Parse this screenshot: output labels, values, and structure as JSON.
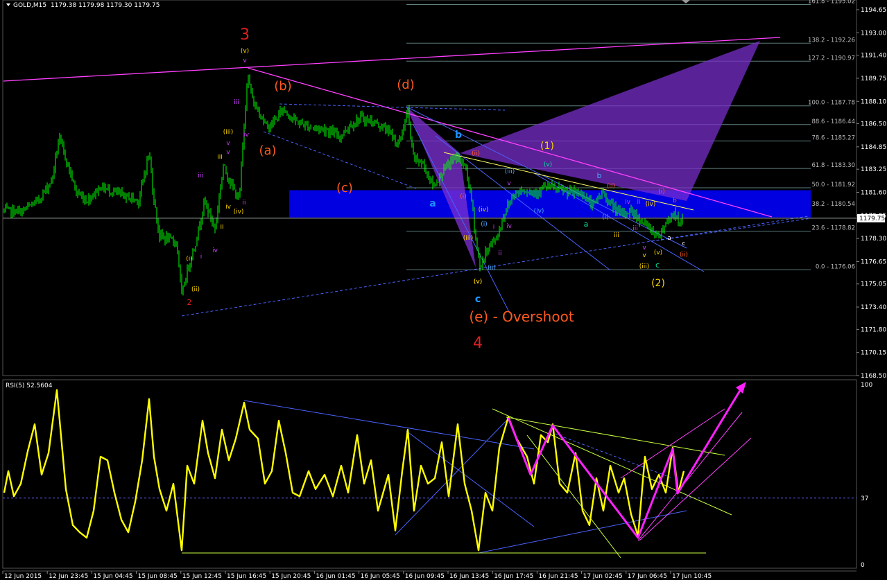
{
  "header": {
    "symbol_label": "GOLD,M15",
    "ohlc": "1179.38 1179.98 1179.30 1179.75",
    "rsi_label": "RSI(5) 52.5604"
  },
  "colors": {
    "background": "#000000",
    "candle": "#00ff00",
    "rsi_line": "#ffff00",
    "fib_line": "#5f7f7f",
    "zone": "#0000e0",
    "pattern": "#7b2fd0",
    "trendline": "#ff40ff",
    "channel": "#4a63ff"
  },
  "chart_data": [
    {
      "type": "candlestick",
      "price_axis": {
        "ticks": [
          "1194.65",
          "1193.00",
          "1191.40",
          "1189.75",
          "1188.10",
          "1186.50",
          "1184.85",
          "1183.25",
          "1181.60",
          "1179.95",
          "1178.30",
          "1176.65",
          "1175.05",
          "1173.40",
          "1171.80",
          "1170.15",
          "1168.50"
        ],
        "current_price": "1179.75",
        "ylim": [
          1168.1,
          1195.2
        ]
      },
      "x_axis": {
        "ticks": [
          "12 Jun 2015",
          "12 Jun 23:45",
          "15 Jun 04:45",
          "15 Jun 08:45",
          "15 Jun 12:45",
          "15 Jun 16:45",
          "15 Jun 20:45",
          "16 Jun 01:45",
          "16 Jun 05:45",
          "16 Jun 09:45",
          "16 Jun 13:45",
          "16 Jun 17:45",
          "16 Jun 21:45",
          "17 Jun 02:45",
          "17 Jun 06:45",
          "17 Jun 10:45"
        ]
      },
      "fibonacci": [
        {
          "label": "161.8 - 1195.02",
          "price": 1195.02
        },
        {
          "label": "138.2 - 1192.26",
          "price": 1192.26
        },
        {
          "label": "127.2 - 1190.97",
          "price": 1190.97
        },
        {
          "label": "100.0 - 1187.78",
          "price": 1187.78
        },
        {
          "label": "88.6 - 1186.44",
          "price": 1186.44
        },
        {
          "label": "78.6 - 1185.27",
          "price": 1185.27
        },
        {
          "label": "61.8 - 1183.30",
          "price": 1183.3
        },
        {
          "label": "50.0 - 1181.92",
          "price": 1181.92
        },
        {
          "label": "38.2 - 1180.54",
          "price": 1180.54
        },
        {
          "label": "23.6 - 1178.82",
          "price": 1178.82
        },
        {
          "label": "0.0 - 1176.06",
          "price": 1176.06
        }
      ],
      "zone": {
        "from": 1179.8,
        "to": 1181.75
      },
      "wave_labels": [
        {
          "text": "3",
          "color": "#e02020",
          "size": 22
        },
        {
          "text": "(v)",
          "color": "#ffd700",
          "size": 9
        },
        {
          "text": "v",
          "color": "#d040ff",
          "size": 9
        },
        {
          "text": "(b)",
          "color": "#ff5a1f",
          "size": 18
        },
        {
          "text": "(d)",
          "color": "#ff5a1f",
          "size": 18
        },
        {
          "text": "(a)",
          "color": "#ff5a1f",
          "size": 18
        },
        {
          "text": "(c)",
          "color": "#ff5a1f",
          "size": 18
        },
        {
          "text": "iii",
          "color": "#d040ff",
          "size": 9
        },
        {
          "text": "iv",
          "color": "#d040ff",
          "size": 9
        },
        {
          "text": "(iii)",
          "color": "#ffd700",
          "size": 9
        },
        {
          "text": "v",
          "color": "#d040ff",
          "size": 9
        },
        {
          "text": "v",
          "color": "#d040ff",
          "size": 9
        },
        {
          "text": "iii",
          "color": "#ffd700",
          "size": 9
        },
        {
          "text": "iii",
          "color": "#d040ff",
          "size": 9
        },
        {
          "text": "iv",
          "color": "#ffd700",
          "size": 9
        },
        {
          "text": "(iv)",
          "color": "#ffd700",
          "size": 9
        },
        {
          "text": "ii",
          "color": "#d040ff",
          "size": 9
        },
        {
          "text": "ii",
          "color": "#ffd700",
          "size": 9
        },
        {
          "text": "iv",
          "color": "#d040ff",
          "size": 9
        },
        {
          "text": "(i)",
          "color": "#ffd700",
          "size": 9
        },
        {
          "text": "i",
          "color": "#d040ff",
          "size": 9
        },
        {
          "text": "(ii)",
          "color": "#ffd700",
          "size": 9
        },
        {
          "text": "2",
          "color": "#e02020",
          "size": 11
        },
        {
          "text": "b",
          "color": "#1e90ff",
          "size": 14
        },
        {
          "text": "a",
          "color": "#1e90ff",
          "size": 14
        },
        {
          "text": "(ii)",
          "color": "#ff5a1f",
          "size": 9
        },
        {
          "text": "(i)",
          "color": "#ff5a1f",
          "size": 9
        },
        {
          "text": "(iv)",
          "color": "#ffd700",
          "size": 9
        },
        {
          "text": "(iii)",
          "color": "#ffd700",
          "size": 9
        },
        {
          "text": "(i)",
          "color": "#4aa8ff",
          "size": 9
        },
        {
          "text": "i",
          "color": "#d040ff",
          "size": 9
        },
        {
          "text": "ii",
          "color": "#d040ff",
          "size": 9
        },
        {
          "text": "iv",
          "color": "#d040ff",
          "size": 9
        },
        {
          "text": "(ii)",
          "color": "#4aa8ff",
          "size": 9
        },
        {
          "text": "(v)",
          "color": "#ffd700",
          "size": 9
        },
        {
          "text": "c",
          "color": "#1e90ff",
          "size": 14
        },
        {
          "text": "(iii)",
          "color": "#4aa8ff",
          "size": 9
        },
        {
          "text": "v",
          "color": "#d040ff",
          "size": 9
        },
        {
          "text": "(iv)",
          "color": "#4aa8ff",
          "size": 9
        },
        {
          "text": "(v)",
          "color": "#00e0a0",
          "size": 9
        },
        {
          "text": "(1)",
          "color": "#ffd700",
          "size": 14
        },
        {
          "text": "b",
          "color": "#4aa8ff",
          "size": 11
        },
        {
          "text": "a",
          "color": "#00e0a0",
          "size": 11
        },
        {
          "text": "(ii)",
          "color": "#ff5a1f",
          "size": 9
        },
        {
          "text": "(i)",
          "color": "#4aa8ff",
          "size": 9
        },
        {
          "text": "iii",
          "color": "#ffd700",
          "size": 9
        },
        {
          "text": "iv",
          "color": "#d040ff",
          "size": 9
        },
        {
          "text": "ii",
          "color": "#d040ff",
          "size": 9
        },
        {
          "text": "(i)",
          "color": "#ff5a1f",
          "size": 9
        },
        {
          "text": "(iv)",
          "color": "#ffd700",
          "size": 9
        },
        {
          "text": "iii",
          "color": "#d040ff",
          "size": 9
        },
        {
          "text": "v",
          "color": "#d040ff",
          "size": 9
        },
        {
          "text": "v",
          "color": "#ffd700",
          "size": 9
        },
        {
          "text": "(iii)",
          "color": "#ffd700",
          "size": 9
        },
        {
          "text": "(v)",
          "color": "#ffd700",
          "size": 9
        },
        {
          "text": "c",
          "color": "#00e0a0",
          "size": 11
        },
        {
          "text": "b",
          "color": "#ff5a1f",
          "size": 9
        },
        {
          "text": "a",
          "color": "#ffffff",
          "size": 9
        },
        {
          "text": "c",
          "color": "#ffffff",
          "size": 9
        },
        {
          "text": "(ii)",
          "color": "#ff5a1f",
          "size": 9
        },
        {
          "text": "(2)",
          "color": "#ffd700",
          "size": 14
        },
        {
          "text": "(v)",
          "color": "#ffd700",
          "size": 9
        },
        {
          "text": "c",
          "color": "#1e90ff",
          "size": 14
        },
        {
          "text": "(e) - Overshoot",
          "color": "#ff5a1f",
          "size": 20
        },
        {
          "text": "4",
          "color": "#e02020",
          "size": 22
        }
      ]
    },
    {
      "type": "line",
      "name": "RSI(5)",
      "value": 52.5604,
      "y_axis": {
        "ticks": [
          "100",
          "37",
          "0"
        ],
        "ylim": [
          0,
          100
        ]
      },
      "level": 37
    }
  ]
}
